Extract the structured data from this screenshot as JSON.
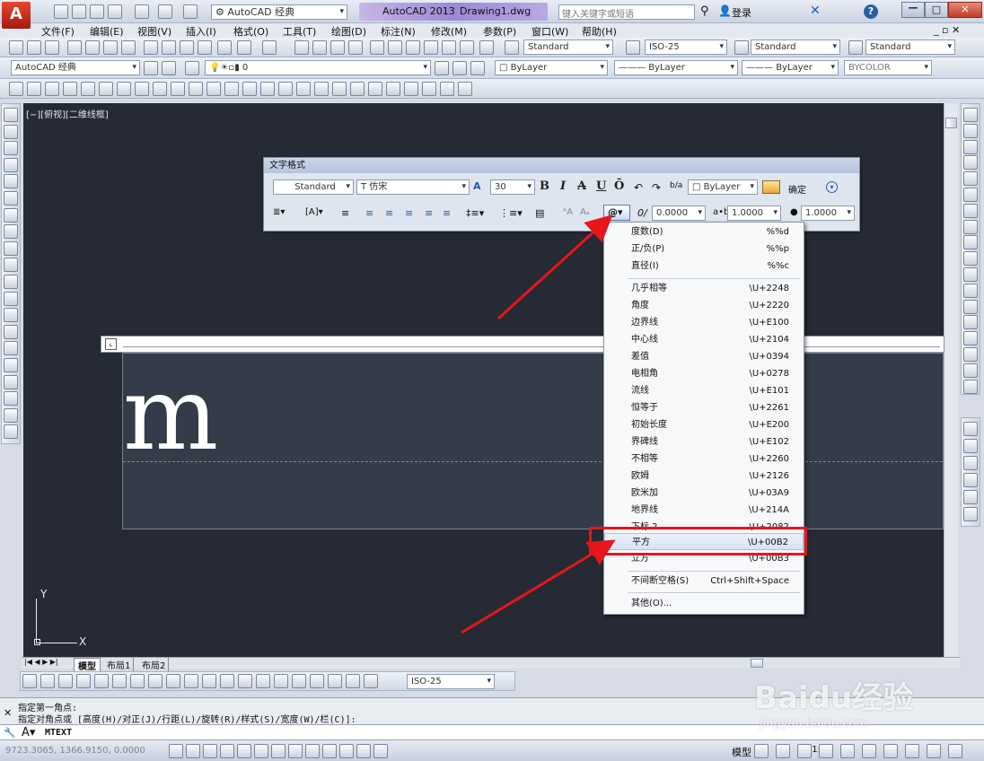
{
  "title_bar": {
    "workspace": "AutoCAD 经典",
    "app_name": "AutoCAD 2013",
    "document": "Drawing1.dwg",
    "search_placeholder": "键入关键字或短语",
    "login": "登录"
  },
  "menu": [
    "文件(F)",
    "编辑(E)",
    "视图(V)",
    "插入(I)",
    "格式(O)",
    "工具(T)",
    "绘图(D)",
    "标注(N)",
    "修改(M)",
    "参数(P)",
    "窗口(W)",
    "帮助(H)"
  ],
  "styles_toolbar": {
    "text_style": "Standard",
    "dim_style": "ISO-25",
    "table_style": "Standard",
    "mleader_style": "Standard"
  },
  "layers_toolbar": {
    "workspace": "AutoCAD 经典",
    "layer": "0",
    "color": "ByLayer",
    "linetype": "ByLayer",
    "lineweight": "ByLayer",
    "plot_style": "BYCOLOR"
  },
  "viewport_label": "[−][俯视][二维线框]",
  "text_format": {
    "title": "文字格式",
    "style": "Standard",
    "font": "T 仿宋",
    "height": "30",
    "bold": "B",
    "italic": "I",
    "strike": "A",
    "underline": "U",
    "overline": "Ō",
    "color": "ByLayer",
    "ok": "确定",
    "oblique": "0.0000",
    "tracking": "1.0000",
    "width_factor": "1.0000",
    "insert_field": "@"
  },
  "editor_text": "m",
  "symbol_menu": [
    {
      "label": "度数(D)",
      "code": "%%d"
    },
    {
      "label": "正/负(P)",
      "code": "%%p"
    },
    {
      "label": "直径(I)",
      "code": "%%c"
    },
    {
      "label": "几乎相等",
      "code": "\\U+2248"
    },
    {
      "label": "角度",
      "code": "\\U+2220"
    },
    {
      "label": "边界线",
      "code": "\\U+E100"
    },
    {
      "label": "中心线",
      "code": "\\U+2104"
    },
    {
      "label": "差值",
      "code": "\\U+0394"
    },
    {
      "label": "电相角",
      "code": "\\U+0278"
    },
    {
      "label": "流线",
      "code": "\\U+E101"
    },
    {
      "label": "恒等于",
      "code": "\\U+2261"
    },
    {
      "label": "初始长度",
      "code": "\\U+E200"
    },
    {
      "label": "界碑线",
      "code": "\\U+E102"
    },
    {
      "label": "不相等",
      "code": "\\U+2260"
    },
    {
      "label": "欧姆",
      "code": "\\U+2126"
    },
    {
      "label": "欧米加",
      "code": "\\U+03A9"
    },
    {
      "label": "地界线",
      "code": "\\U+214A"
    },
    {
      "label": "下标 2",
      "code": "\\U+2082"
    },
    {
      "label": "平方",
      "code": "\\U+00B2"
    },
    {
      "label": "立方",
      "code": "\\U+00B3"
    },
    {
      "label": "不间断空格(S)",
      "code": "Ctrl+Shift+Space"
    },
    {
      "label": "其他(O)...",
      "code": ""
    }
  ],
  "layout_tabs": [
    "模型",
    "布局1",
    "布局2"
  ],
  "dim_style_bottom": "ISO-25",
  "command_lines": [
    "指定第一角点:",
    "指定对角点或 [高度(H)/对正(J)/行距(L)/旋转(R)/样式(S)/宽度(W)/栏(C)]:"
  ],
  "command_input": "MTEXT",
  "coordinates": "9723.3065,  1366.9150,  0.0000",
  "status_model": "模型",
  "annotation_scale": "1:1",
  "watermark": "Baidu经验",
  "watermark_url": "jingyan.baidu.com",
  "axis_x": "X",
  "axis_y": "Y"
}
